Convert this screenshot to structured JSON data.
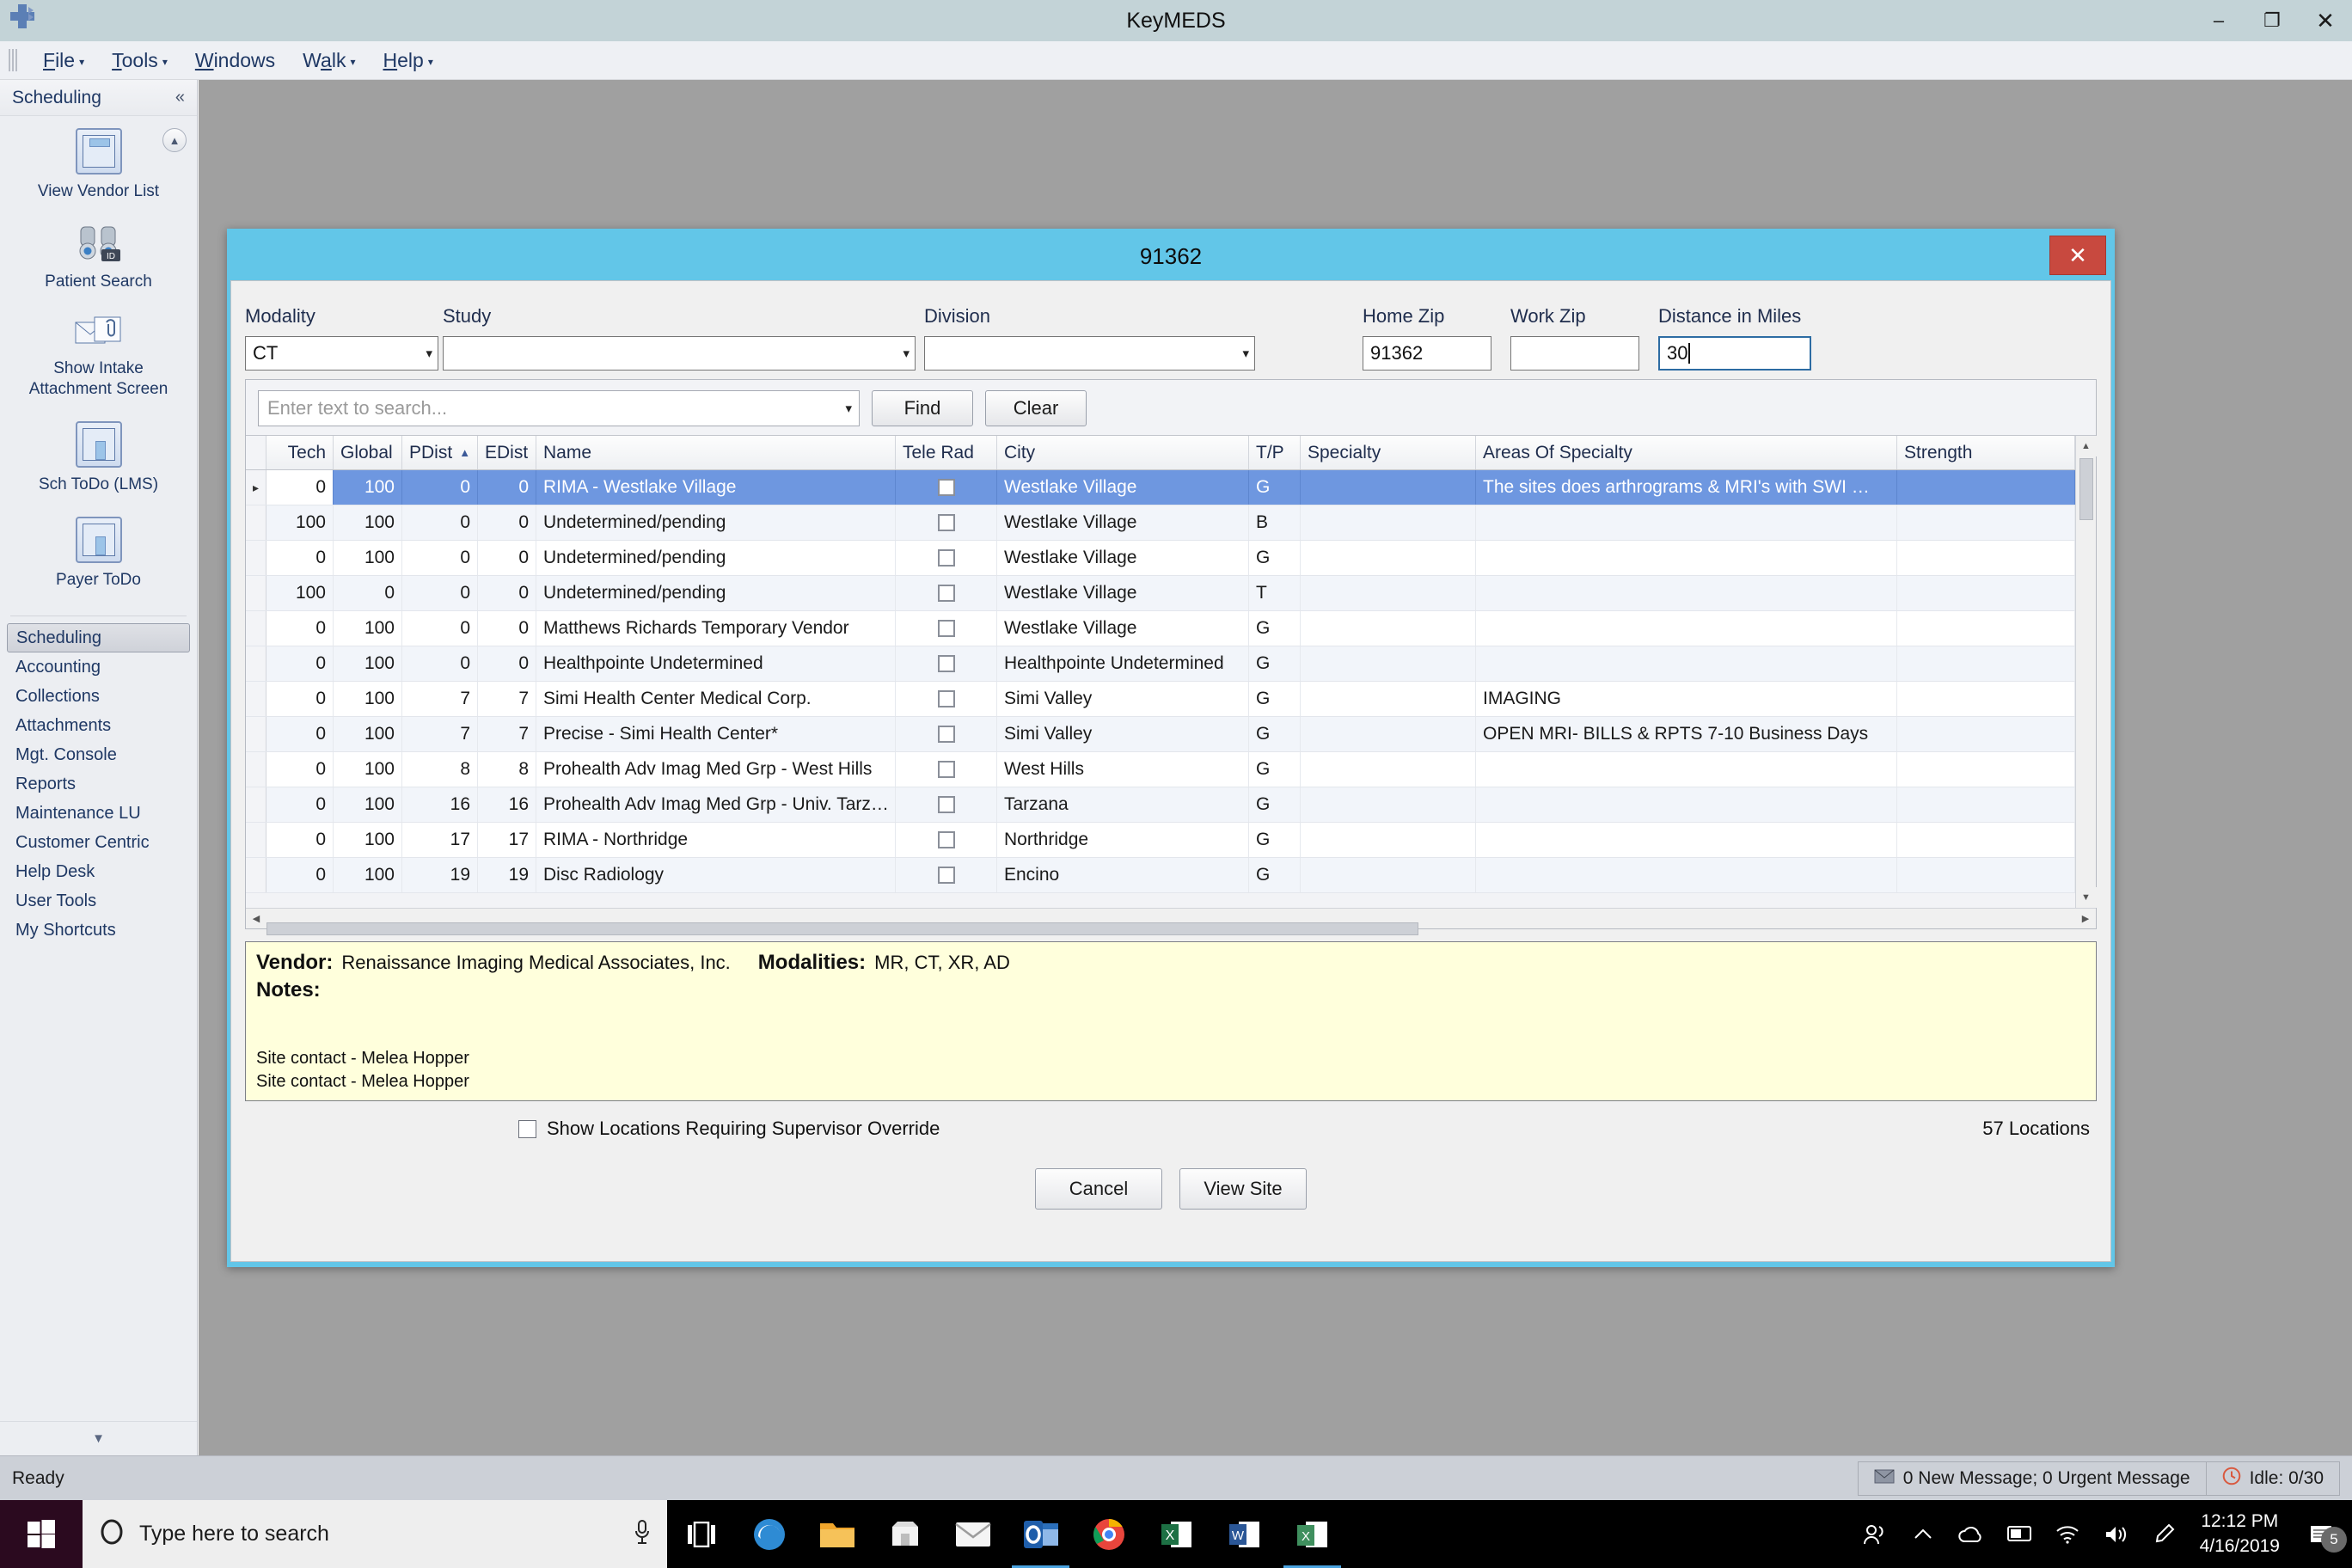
{
  "window": {
    "title": "KeyMEDS",
    "minimize_label": "–",
    "restore_label": "❐",
    "close_label": "✕"
  },
  "menubar": {
    "items": [
      {
        "pre": "",
        "accel": "F",
        "post": "ile",
        "caret": "▾"
      },
      {
        "pre": "",
        "accel": "T",
        "post": "ools",
        "caret": "▾"
      },
      {
        "pre": "",
        "accel": "W",
        "post": "indows",
        "caret": ""
      },
      {
        "pre": "W",
        "accel": "a",
        "post": "lk",
        "caret": "▾"
      },
      {
        "pre": "",
        "accel": "H",
        "post": "elp",
        "caret": "▾"
      }
    ]
  },
  "sidebar": {
    "header_title": "Scheduling",
    "collapse_icon": "«",
    "scroll_up_icon": "▲",
    "scroll_down_icon": "▼",
    "tiles": [
      {
        "label": "View Vendor List",
        "icon": "window-icon"
      },
      {
        "label": "Patient Search",
        "icon": "binoculars-id-icon"
      },
      {
        "label": "Show Intake Attachment Screen",
        "icon": "envelope-attachment-icon"
      },
      {
        "label": "Sch ToDo (LMS)",
        "icon": "window-list-icon"
      },
      {
        "label": "Payer ToDo",
        "icon": "window-list-icon"
      }
    ],
    "nav": [
      {
        "label": "Scheduling",
        "active": true
      },
      {
        "label": "Accounting",
        "active": false
      },
      {
        "label": "Collections",
        "active": false
      },
      {
        "label": "Attachments",
        "active": false
      },
      {
        "label": "Mgt. Console",
        "active": false
      },
      {
        "label": "Reports",
        "active": false
      },
      {
        "label": "Maintenance LU",
        "active": false
      },
      {
        "label": "Customer Centric",
        "active": false
      },
      {
        "label": "Help Desk",
        "active": false
      },
      {
        "label": "User Tools",
        "active": false
      },
      {
        "label": "My Shortcuts",
        "active": false
      }
    ]
  },
  "dialog": {
    "title": "91362",
    "close_label": "✕",
    "fields": {
      "modality": {
        "label": "Modality",
        "value": "CT"
      },
      "study": {
        "label": "Study",
        "value": ""
      },
      "division": {
        "label": "Division",
        "value": ""
      },
      "home_zip": {
        "label": "Home Zip",
        "value": "91362"
      },
      "work_zip": {
        "label": "Work Zip",
        "value": ""
      },
      "distance": {
        "label": "Distance in Miles",
        "value": "30"
      }
    },
    "search": {
      "placeholder": "Enter text to search...",
      "find_label": "Find",
      "clear_label": "Clear",
      "caret": "▾"
    },
    "grid": {
      "columns": [
        {
          "key": "tech",
          "label": "Tech"
        },
        {
          "key": "global",
          "label": "Global"
        },
        {
          "key": "pdist",
          "label": "PDist",
          "sorted": "asc",
          "sort_icon": "▲"
        },
        {
          "key": "edist",
          "label": "EDist"
        },
        {
          "key": "name",
          "label": "Name"
        },
        {
          "key": "telerad",
          "label": "Tele Rad"
        },
        {
          "key": "city",
          "label": "City"
        },
        {
          "key": "tp",
          "label": "T/P"
        },
        {
          "key": "specialty",
          "label": "Specialty"
        },
        {
          "key": "areas",
          "label": "Areas Of Specialty"
        },
        {
          "key": "strength",
          "label": "Strength"
        }
      ],
      "rows": [
        {
          "selected": true,
          "marker": "▸",
          "tech": "0",
          "global": "100",
          "pdist": "0",
          "edist": "0",
          "name": "RIMA - Westlake Village",
          "telerad": false,
          "city": "Westlake Village",
          "tp": "G",
          "specialty": "",
          "areas": "The sites does arthrograms & MRI's with SWI …",
          "strength": ""
        },
        {
          "selected": false,
          "marker": "",
          "tech": "100",
          "global": "100",
          "pdist": "0",
          "edist": "0",
          "name": "Undetermined/pending",
          "telerad": false,
          "city": "Westlake Village",
          "tp": "B",
          "specialty": "",
          "areas": "",
          "strength": ""
        },
        {
          "selected": false,
          "marker": "",
          "tech": "0",
          "global": "100",
          "pdist": "0",
          "edist": "0",
          "name": "Undetermined/pending",
          "telerad": false,
          "city": "Westlake Village",
          "tp": "G",
          "specialty": "",
          "areas": "",
          "strength": ""
        },
        {
          "selected": false,
          "marker": "",
          "tech": "100",
          "global": "0",
          "pdist": "0",
          "edist": "0",
          "name": "Undetermined/pending",
          "telerad": false,
          "city": "Westlake Village",
          "tp": "T",
          "specialty": "",
          "areas": "",
          "strength": ""
        },
        {
          "selected": false,
          "marker": "",
          "tech": "0",
          "global": "100",
          "pdist": "0",
          "edist": "0",
          "name": "Matthews Richards Temporary Vendor",
          "telerad": false,
          "city": "Westlake Village",
          "tp": "G",
          "specialty": "",
          "areas": "",
          "strength": ""
        },
        {
          "selected": false,
          "marker": "",
          "tech": "0",
          "global": "100",
          "pdist": "0",
          "edist": "0",
          "name": "Healthpointe Undetermined",
          "telerad": false,
          "city": "Healthpointe Undetermined",
          "tp": "G",
          "specialty": "",
          "areas": "",
          "strength": ""
        },
        {
          "selected": false,
          "marker": "",
          "tech": "0",
          "global": "100",
          "pdist": "7",
          "edist": "7",
          "name": "Simi Health Center Medical Corp.",
          "telerad": false,
          "city": "Simi Valley",
          "tp": "G",
          "specialty": "",
          "areas": "IMAGING",
          "strength": ""
        },
        {
          "selected": false,
          "marker": "",
          "tech": "0",
          "global": "100",
          "pdist": "7",
          "edist": "7",
          "name": "Precise - Simi Health Center*",
          "telerad": false,
          "city": "Simi Valley",
          "tp": "G",
          "specialty": "",
          "areas": "OPEN MRI- BILLS & RPTS 7-10 Business Days",
          "strength": ""
        },
        {
          "selected": false,
          "marker": "",
          "tech": "0",
          "global": "100",
          "pdist": "8",
          "edist": "8",
          "name": "Prohealth Adv Imag Med Grp - West Hills",
          "telerad": false,
          "city": "West Hills",
          "tp": "G",
          "specialty": "",
          "areas": "",
          "strength": ""
        },
        {
          "selected": false,
          "marker": "",
          "tech": "0",
          "global": "100",
          "pdist": "16",
          "edist": "16",
          "name": "Prohealth Adv Imag Med Grp - Univ. Tarz…",
          "telerad": false,
          "city": "Tarzana",
          "tp": "G",
          "specialty": "",
          "areas": "",
          "strength": ""
        },
        {
          "selected": false,
          "marker": "",
          "tech": "0",
          "global": "100",
          "pdist": "17",
          "edist": "17",
          "name": "RIMA - Northridge",
          "telerad": false,
          "city": "Northridge",
          "tp": "G",
          "specialty": "",
          "areas": "",
          "strength": ""
        },
        {
          "selected": false,
          "marker": "",
          "tech": "0",
          "global": "100",
          "pdist": "19",
          "edist": "19",
          "name": "Disc Radiology",
          "telerad": false,
          "city": "Encino",
          "tp": "G",
          "specialty": "",
          "areas": "",
          "strength": ""
        }
      ]
    },
    "notes": {
      "vendor_label": "Vendor:",
      "vendor_value": "Renaissance Imaging Medical Associates, Inc.",
      "modalities_label": "Modalities:",
      "modalities_value": "MR, CT, XR, AD",
      "notes_label": "Notes:",
      "body_line1": "Site contact - Melea Hopper",
      "body_line2": "Site contact - Melea Hopper"
    },
    "footer": {
      "override_checkbox_label": "Show Locations Requiring Supervisor Override",
      "override_checked": false,
      "locations_count": "57 Locations",
      "cancel_label": "Cancel",
      "view_site_label": "View Site"
    }
  },
  "statusbar": {
    "state": "Ready",
    "messages": "0 New Message;  0 Urgent Message",
    "messages_icon": "envelope-icon",
    "idle": "Idle: 0/30",
    "idle_icon": "clock-icon"
  },
  "taskbar": {
    "start_icon": "windows-logo-icon",
    "search_placeholder": "Type here to search",
    "cortana_icon": "cortana-circle-icon",
    "mic_icon": "microphone-icon",
    "taskview_icon": "task-view-icon",
    "apps": [
      {
        "name": "edge-icon",
        "color": "#2e8bd4",
        "glyph": "e"
      },
      {
        "name": "file-explorer-icon",
        "color": "#f0a52b",
        "glyph": "▭"
      },
      {
        "name": "microsoft-store-icon",
        "color": "#f2f2f2",
        "glyph": "▤"
      },
      {
        "name": "mail-icon",
        "color": "#f4f4f4",
        "glyph": "✉"
      },
      {
        "name": "outlook-icon",
        "color": "#2b6fbb",
        "glyph": "O"
      },
      {
        "name": "chrome-icon",
        "color": "#e8453c",
        "glyph": "●"
      },
      {
        "name": "excel-icon",
        "color": "#1d7044",
        "glyph": "X"
      },
      {
        "name": "word-icon",
        "color": "#2b5797",
        "glyph": "W"
      },
      {
        "name": "keymeds-app-icon",
        "color": "#3f8f5e",
        "glyph": "✕"
      }
    ],
    "tray": [
      {
        "name": "people-icon",
        "glyph": "☍"
      },
      {
        "name": "show-hidden-icons-icon",
        "glyph": "⌃"
      },
      {
        "name": "onedrive-icon",
        "glyph": "☁"
      },
      {
        "name": "display-icon",
        "glyph": "▭"
      },
      {
        "name": "network-icon",
        "glyph": "◠"
      },
      {
        "name": "volume-icon",
        "glyph": "🔊"
      },
      {
        "name": "pen-icon",
        "glyph": "✐"
      }
    ],
    "time": "12:12 PM",
    "date": "4/16/2019",
    "notification_icon": "action-center-icon",
    "notification_count": "5"
  }
}
